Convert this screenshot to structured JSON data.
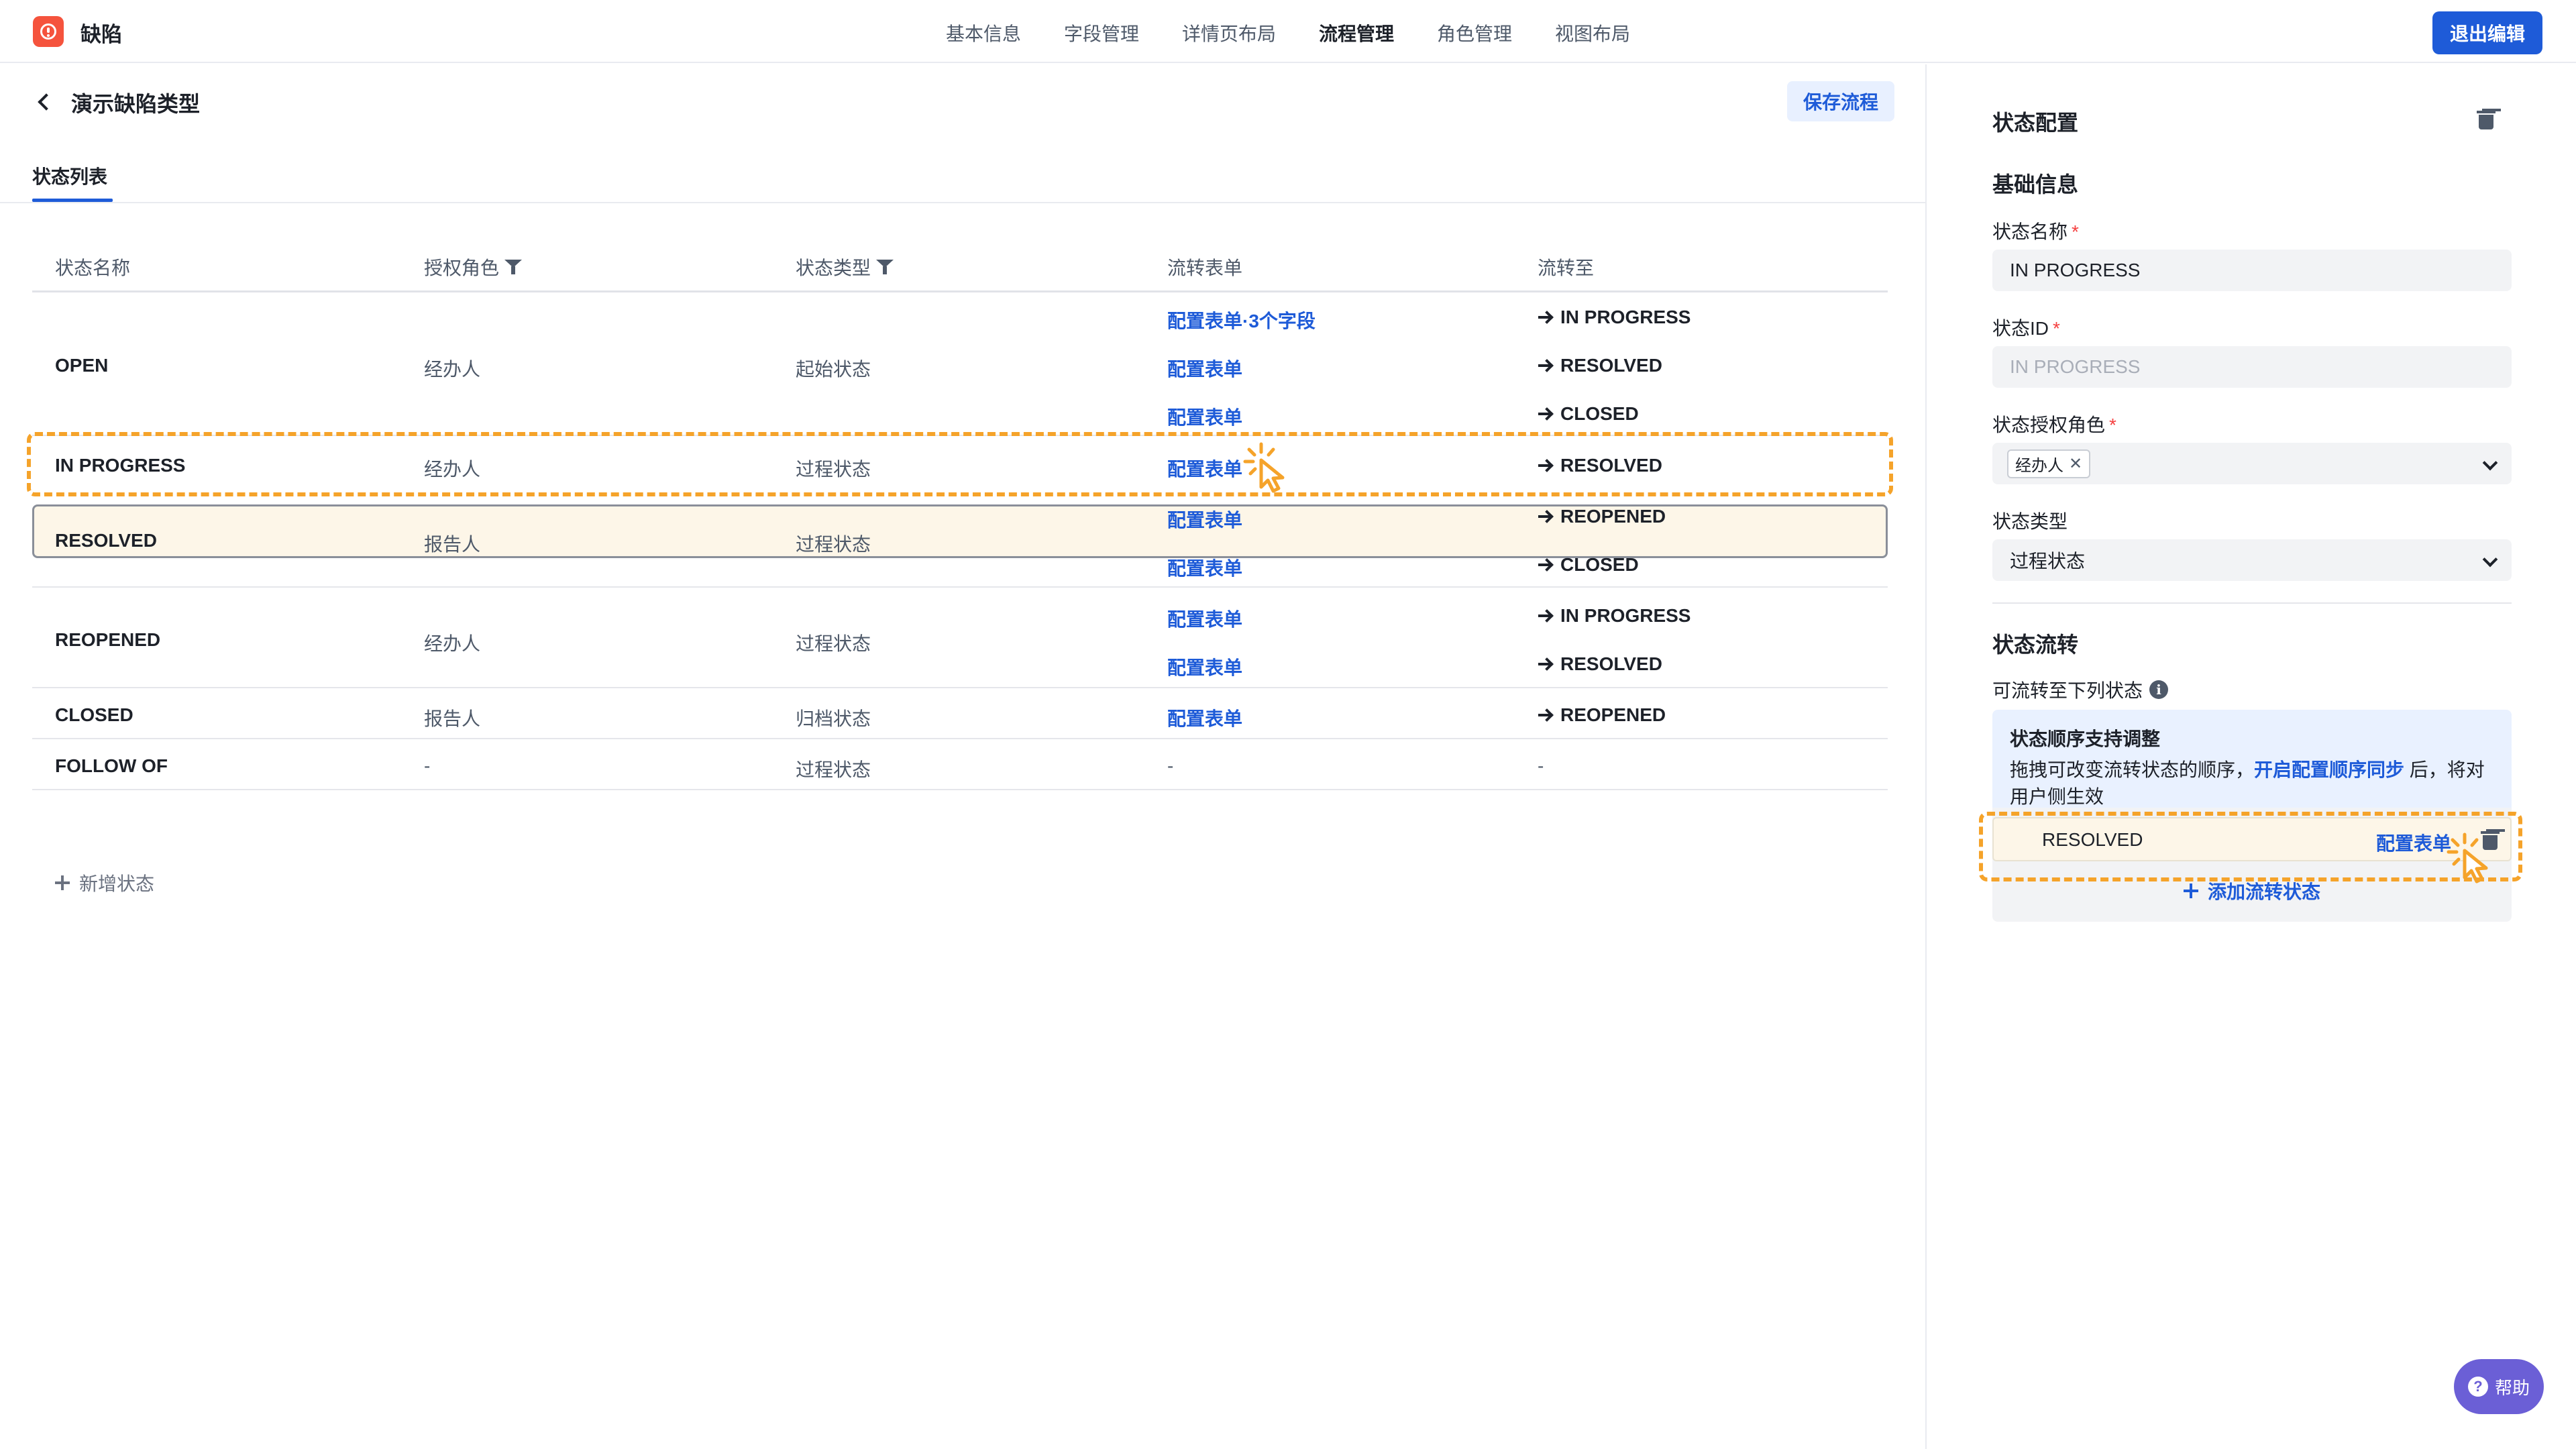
{
  "app": {
    "title": "缺陷"
  },
  "nav": {
    "items": [
      "基本信息",
      "字段管理",
      "详情页布局",
      "流程管理",
      "角色管理",
      "视图布局"
    ],
    "active": "流程管理",
    "exit_label": "退出编辑"
  },
  "main": {
    "title": "演示缺陷类型",
    "save_label": "保存流程",
    "tab": "状态列表",
    "columns": [
      "状态名称",
      "授权角色",
      "状态类型",
      "流转表单",
      "流转至"
    ],
    "rows": [
      {
        "name": "OPEN",
        "role": "经办人",
        "type": "起始状态",
        "transitions": [
          {
            "form": "配置表单·3个字段",
            "to": "IN PROGRESS"
          },
          {
            "form": "配置表单",
            "to": "RESOLVED"
          },
          {
            "form": "配置表单",
            "to": "CLOSED"
          }
        ]
      },
      {
        "name": "IN PROGRESS",
        "role": "经办人",
        "type": "过程状态",
        "transitions": [
          {
            "form": "配置表单",
            "to": "RESOLVED"
          }
        ]
      },
      {
        "name": "RESOLVED",
        "role": "报告人",
        "type": "过程状态",
        "transitions": [
          {
            "form": "配置表单",
            "to": "REOPENED"
          },
          {
            "form": "配置表单",
            "to": "CLOSED"
          }
        ]
      },
      {
        "name": "REOPENED",
        "role": "经办人",
        "type": "过程状态",
        "transitions": [
          {
            "form": "配置表单",
            "to": "IN PROGRESS"
          },
          {
            "form": "配置表单",
            "to": "RESOLVED"
          }
        ]
      },
      {
        "name": "CLOSED",
        "role": "报告人",
        "type": "归档状态",
        "transitions": [
          {
            "form": "配置表单",
            "to": "REOPENED"
          }
        ]
      },
      {
        "name": "FOLLOW OF",
        "role": "-",
        "type": "过程状态",
        "transitions": [
          {
            "form": "-",
            "to": "-"
          }
        ]
      }
    ],
    "add_state_label": "新增状态"
  },
  "panel": {
    "title": "状态配置",
    "basic_section": "基础信息",
    "name_label": "状态名称",
    "name_value": "IN PROGRESS",
    "id_label": "状态ID",
    "id_placeholder": "IN PROGRESS",
    "role_label": "状态授权角色",
    "role_tag": "经办人",
    "type_label": "状态类型",
    "type_value": "过程状态",
    "flow_section": "状态流转",
    "flow_label": "可流转至下列状态",
    "notice_title": "状态顺序支持调整",
    "notice_text_1": "拖拽可改变流转状态的顺序，",
    "notice_link": "开启配置顺序同步",
    "notice_text_2": " 后，将对",
    "notice_text_3": "用户侧生效",
    "flow_item_name": "RESOLVED",
    "flow_item_form": "配置表单",
    "add_flow_label": "添加流转状态"
  },
  "help": {
    "label": "帮助"
  },
  "colors": {
    "accent": "#1e5bd8",
    "logo": "#f5533d",
    "highlight_dash": "#f5a32a",
    "help": "#6b5fd6"
  }
}
